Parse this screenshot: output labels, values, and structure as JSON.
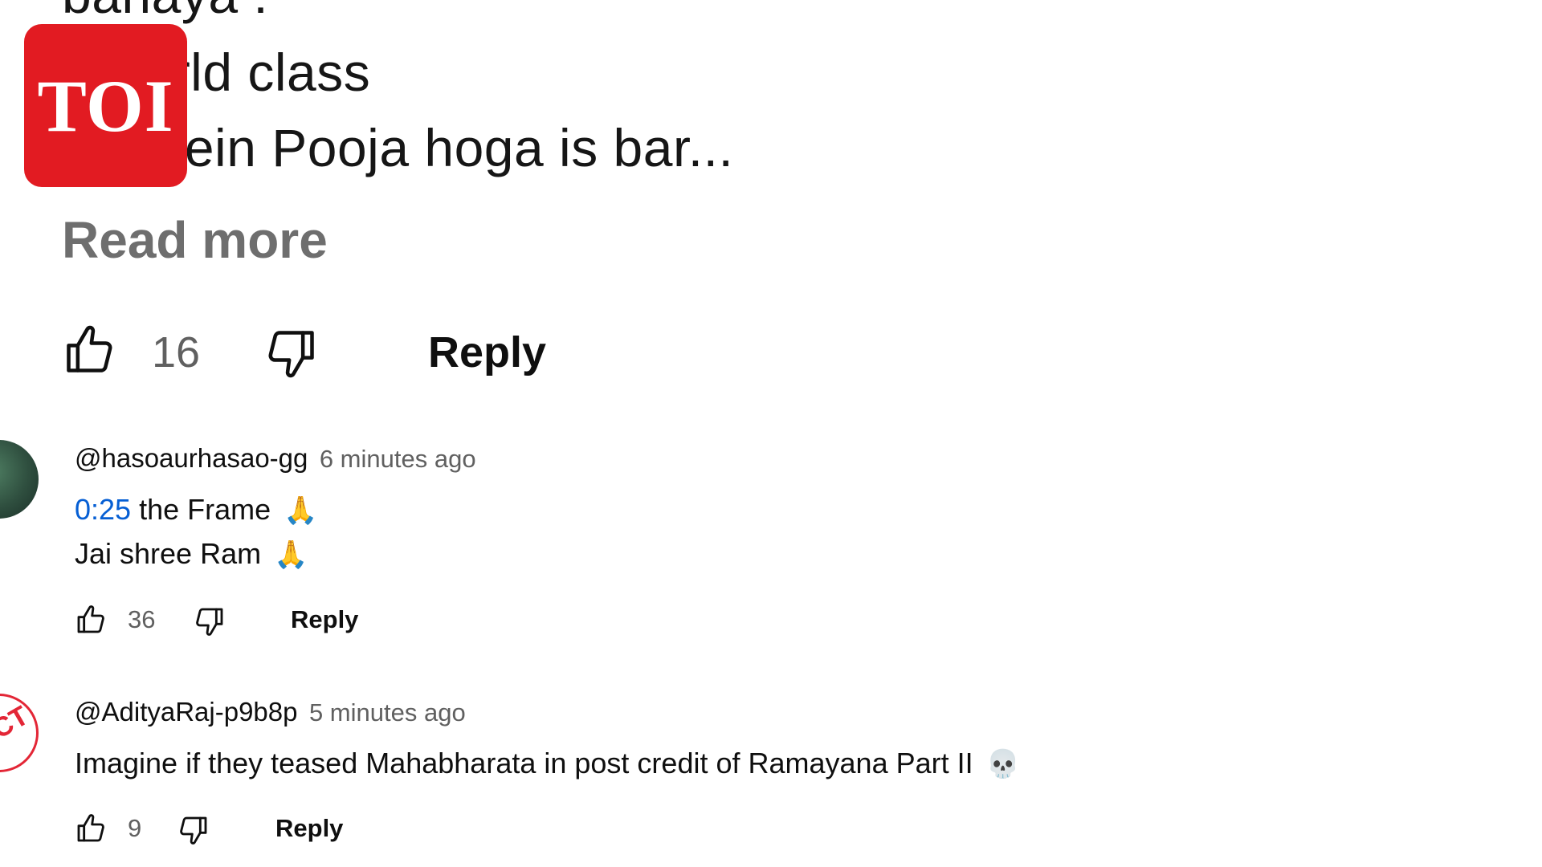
{
  "logo": {
    "text": "TOI",
    "color": "#e21b22"
  },
  "top_comment": {
    "lines": [
      "banaya :",
      "s world class",
      "tre mein Pooja hoga is bar..."
    ],
    "read_more": "Read more",
    "likes": "16",
    "reply_label": "Reply"
  },
  "comments": [
    {
      "handle": "@hasoaurhasao-gg",
      "time": "6 minutes ago",
      "timestamp_link": "0:25",
      "line1_rest": " the Frame",
      "line1_emoji": "🙏",
      "line2": "Jai shree Ram",
      "line2_emoji": "🙏",
      "likes": "36",
      "reply_label": "Reply"
    },
    {
      "handle": "@AdityaRaj-p9b8p",
      "time": "5 minutes ago",
      "text": "Imagine if they teased Mahabharata in post credit of Ramayana Part II",
      "emoji": "💀",
      "avatar_text": "ACT",
      "likes": "9",
      "reply_label": "Reply"
    }
  ],
  "icons": {
    "like": "thumbs-up-icon",
    "dislike": "thumbs-down-icon"
  },
  "colors": {
    "link": "#065fd4",
    "secondary_text": "#606060",
    "read_more": "#6e6e6e"
  }
}
